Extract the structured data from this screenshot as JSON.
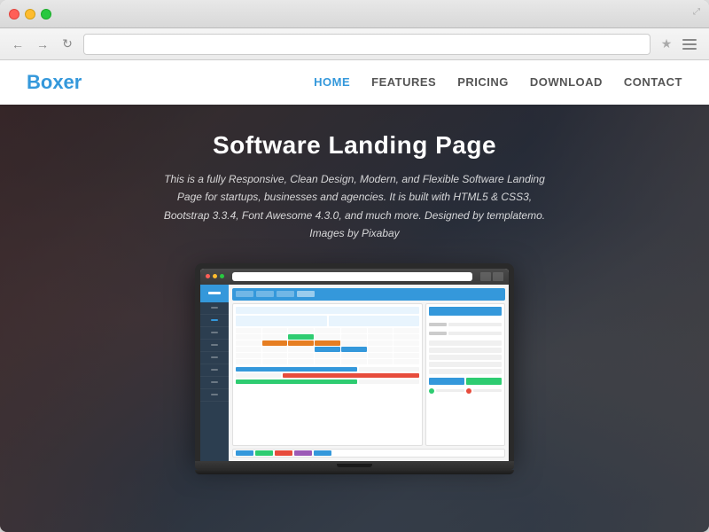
{
  "browser": {
    "address": "",
    "nav_back": "←",
    "nav_forward": "→",
    "nav_refresh": "↻",
    "star": "★",
    "fullscreen_icon": "⤢"
  },
  "site": {
    "logo": "Boxer",
    "nav": {
      "home": "HOME",
      "features": "FEATURES",
      "pricing": "PRICING",
      "download": "DOWNLOAD",
      "contact": "CONTACT"
    }
  },
  "hero": {
    "title": "Software Landing Page",
    "subtitle": "This is a fully Responsive, Clean Design, Modern, and Flexible Software Landing Page for startups, businesses and agencies. It is built with HTML5 & CSS3, Bootstrap 3.3.4, Font Awesome 4.3.0, and much more. Designed by templatemo. Images by Pixabay"
  },
  "mini_ui": {
    "colors": {
      "blue": "#3498db",
      "green": "#2ecc71",
      "orange": "#e67e22",
      "red": "#e74c3c"
    }
  }
}
